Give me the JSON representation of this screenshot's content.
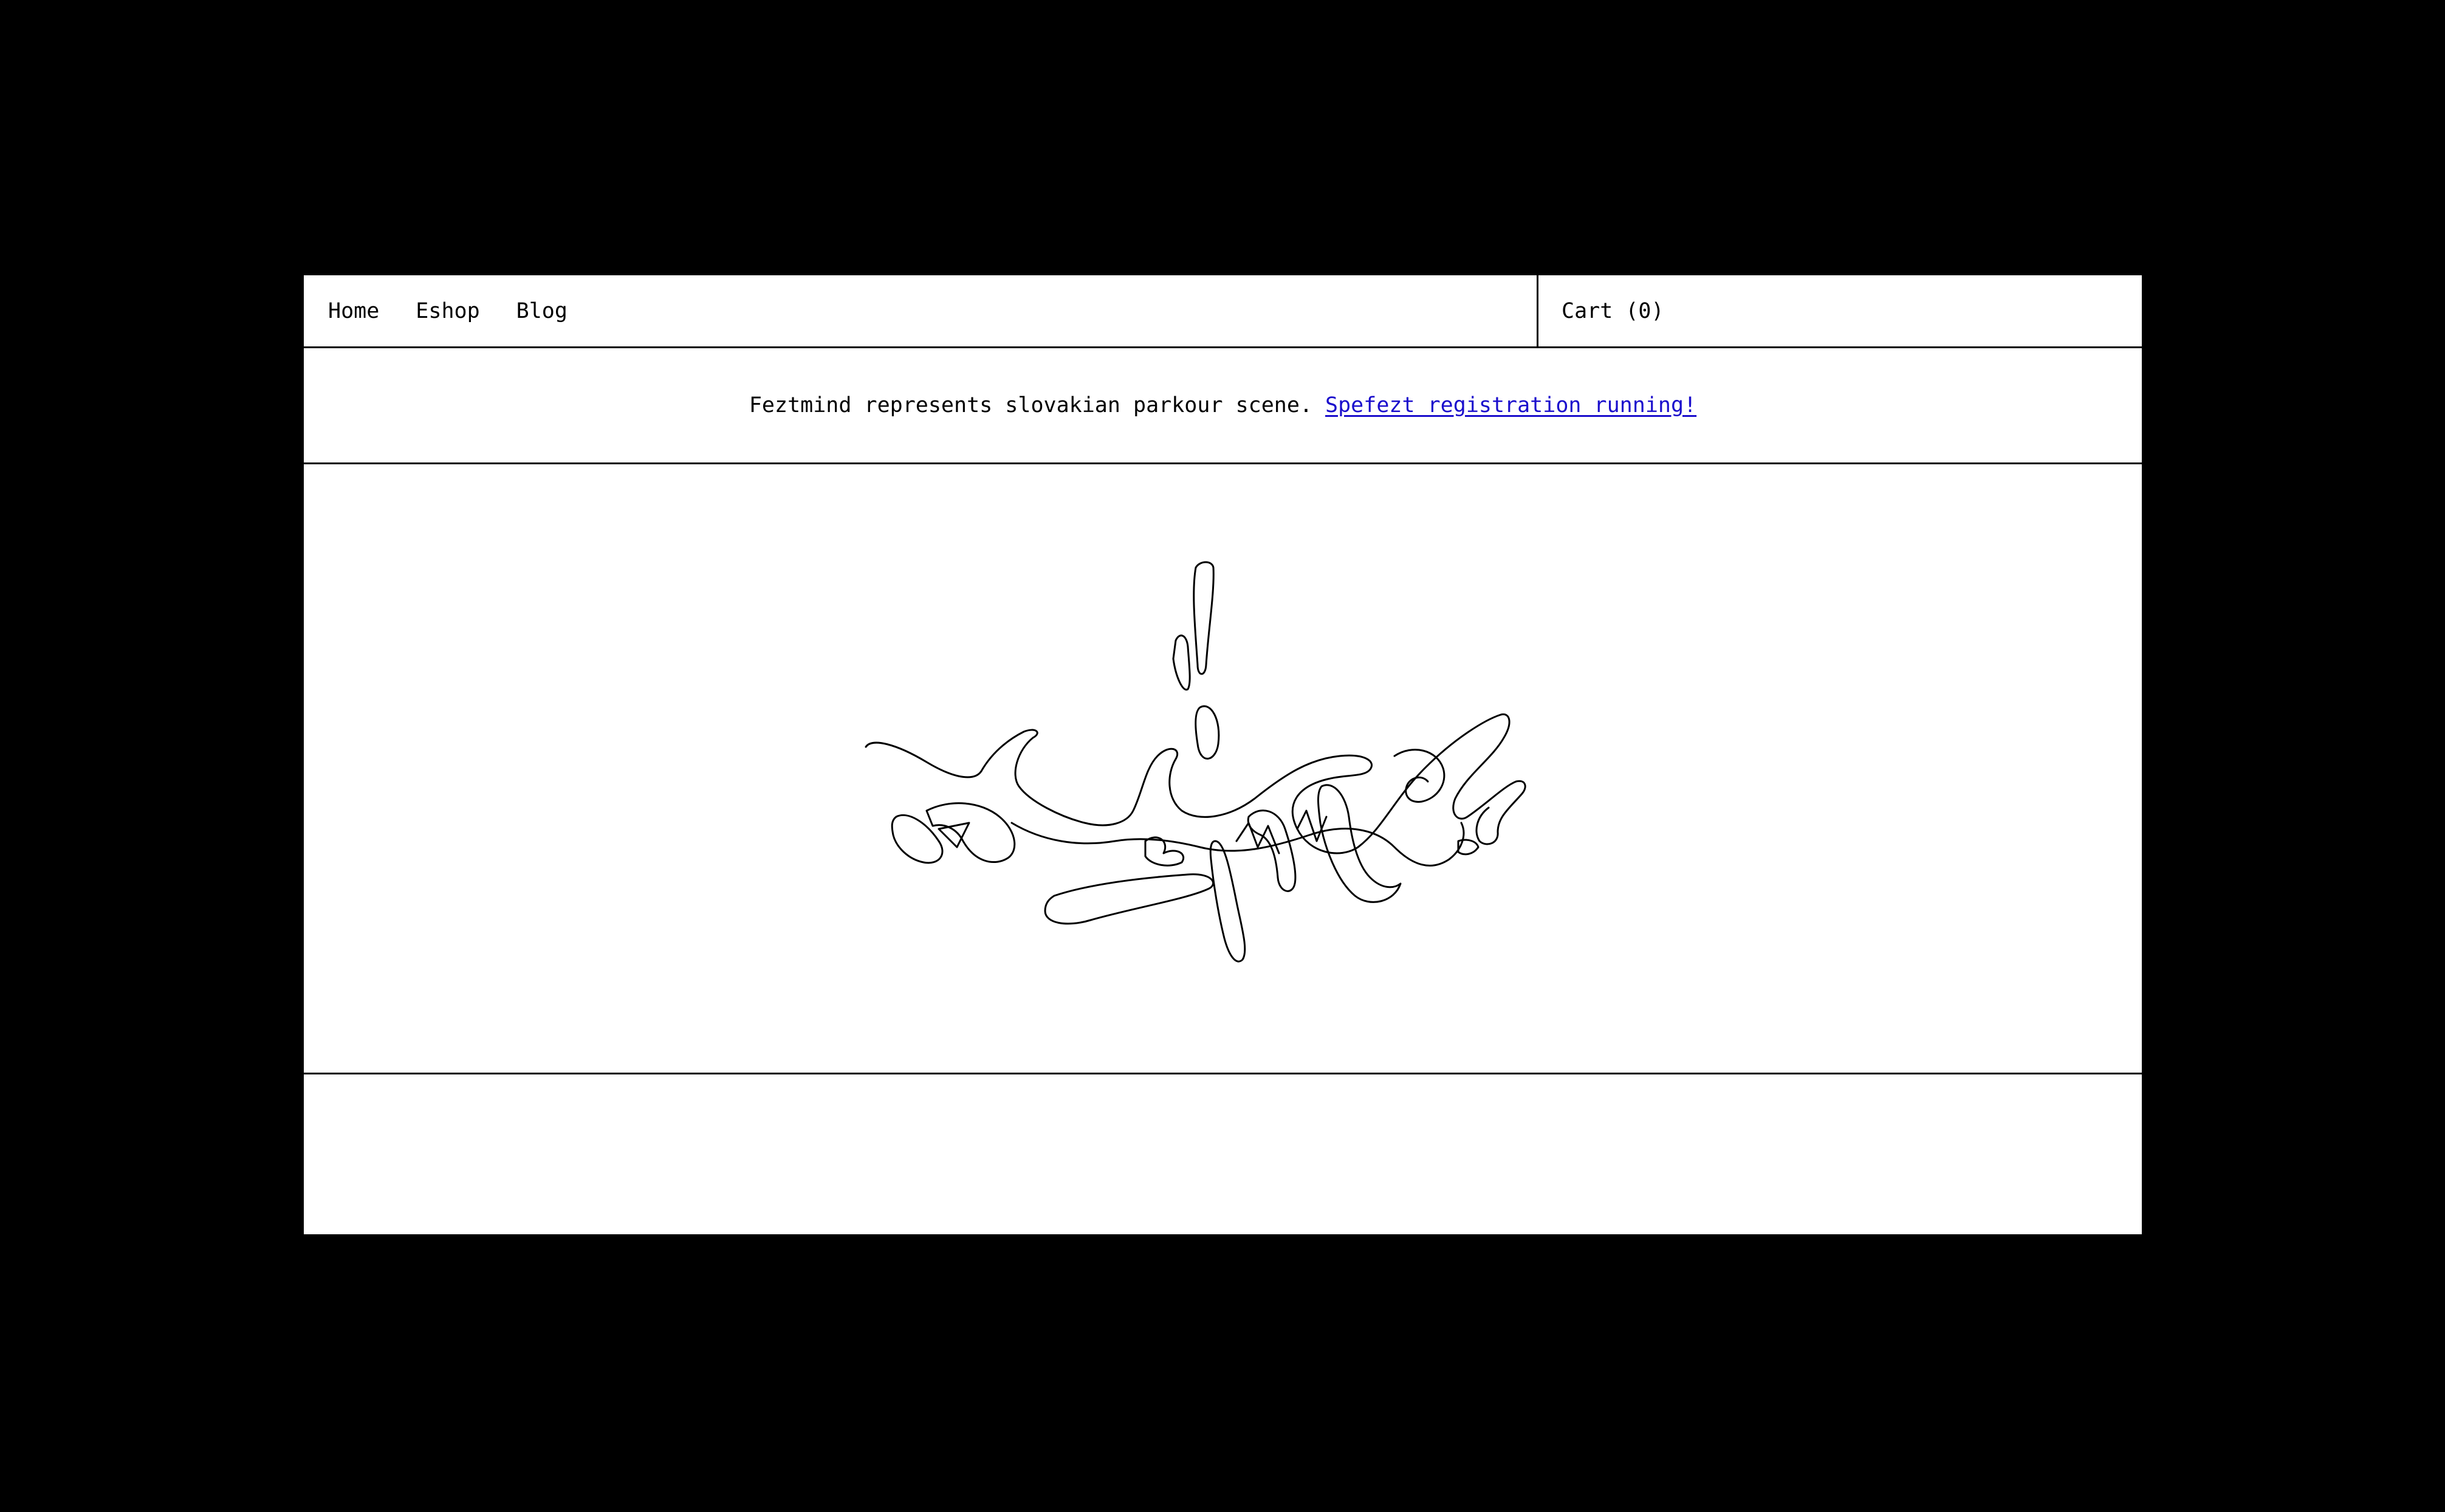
{
  "nav": {
    "items": [
      {
        "label": "Home"
      },
      {
        "label": "Eshop"
      },
      {
        "label": "Blog"
      }
    ],
    "cart_label": "Cart (0)"
  },
  "announcement": {
    "text": "Feztmind represents slovakian parkour scene.",
    "link_text": "Spefezt registration running!"
  },
  "colors": {
    "background": "#000000",
    "panel": "#ffffff",
    "link": "#1a0dcc"
  },
  "hero": {
    "logo_text": "Feztmind"
  }
}
